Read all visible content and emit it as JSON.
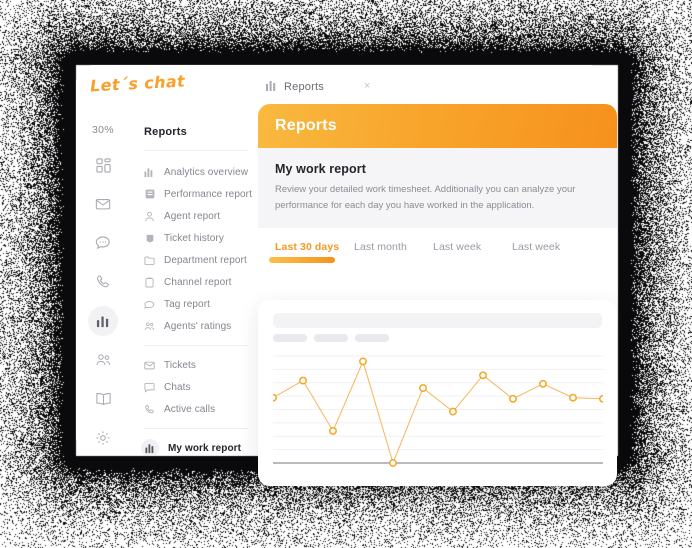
{
  "app": {
    "logo": "Let´s chat",
    "tab": {
      "label": "Reports",
      "icon": "bar-chart-icon",
      "close": "×"
    }
  },
  "rail": {
    "percent": "30%",
    "icons": [
      {
        "name": "grid-icon",
        "active": false
      },
      {
        "name": "mail-icon",
        "active": false
      },
      {
        "name": "chat-icon",
        "active": false
      },
      {
        "name": "phone-icon",
        "active": false
      },
      {
        "name": "bar-chart-icon",
        "active": true
      },
      {
        "name": "people-icon",
        "active": false
      },
      {
        "name": "book-icon",
        "active": false
      },
      {
        "name": "gear-icon",
        "active": false
      },
      {
        "name": "heart-icon",
        "active": false
      }
    ]
  },
  "reports_column": {
    "title": "Reports",
    "items": [
      {
        "label": "Analytics overview",
        "icon": "bar-chart-icon"
      },
      {
        "label": "Performance report",
        "icon": "square-icon"
      },
      {
        "label": "Agent report",
        "icon": "user-icon"
      },
      {
        "label": "Ticket history",
        "icon": "ticket-icon"
      },
      {
        "label": "Department report",
        "icon": "folder-icon"
      },
      {
        "label": "Channel report",
        "icon": "clipboard-icon"
      },
      {
        "label": "Tag report",
        "icon": "tag-icon"
      },
      {
        "label": "Agents' ratings",
        "icon": "people-icon"
      }
    ],
    "items2": [
      {
        "label": "Tickets",
        "icon": "mail-icon"
      },
      {
        "label": "Chats",
        "icon": "chat-icon"
      },
      {
        "label": "Active calls",
        "icon": "phone-icon"
      }
    ],
    "active_item": {
      "label": "My work report",
      "icon": "bar-chart-icon"
    }
  },
  "panel": {
    "header_title": "Reports",
    "intro_title": "My work report",
    "intro_desc": "Review your detailed work timesheet. Additionally you can analyze your performance for each day you have worked in the application.",
    "tabs": [
      {
        "label": "Last 30 days",
        "active": true
      },
      {
        "label": "Last month",
        "active": false
      },
      {
        "label": "Last week",
        "active": false
      },
      {
        "label": "Last week",
        "active": false
      }
    ]
  },
  "colors": {
    "accent": "#F6921C",
    "accent_light": "#FBBF4B",
    "line": "#F6A83C",
    "grid": "#f1f1f4",
    "axis": "#b9b9bf"
  },
  "chart_data": {
    "type": "line",
    "title": "",
    "xlabel": "",
    "ylabel": "",
    "grid": true,
    "legend": null,
    "x": [
      1,
      2,
      3,
      4,
      5,
      6,
      7,
      8,
      9,
      10,
      11,
      12
    ],
    "values": [
      61,
      77,
      30,
      95,
      0,
      70,
      48,
      82,
      60,
      74,
      61,
      60
    ],
    "ylim": [
      0,
      100
    ],
    "marker": "open-circle",
    "gridlines": 8
  }
}
